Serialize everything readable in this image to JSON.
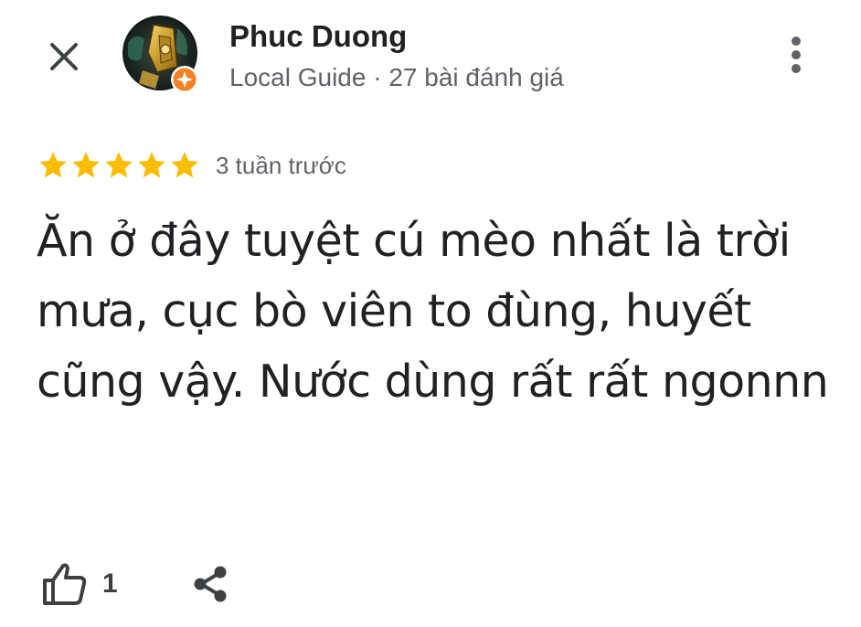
{
  "header": {
    "close_icon": "close-icon",
    "more_icon": "more-vert-icon"
  },
  "reviewer": {
    "name": "Phuc Duong",
    "meta": "Local Guide · 27 bài đánh giá",
    "badge_color": "#f58025"
  },
  "review": {
    "rating": 5,
    "rating_max": 5,
    "star_color": "#fbbc04",
    "time": "3 tuần trước",
    "text": "Ăn ở đây tuyệt cú mèo nhất là trời mưa, cục bò viên to đùng, huyết cũng vậy. Nước dùng rất rất ngonnn"
  },
  "actions": {
    "like_icon": "thumb-up-icon",
    "like_count": "1",
    "share_icon": "share-icon"
  }
}
